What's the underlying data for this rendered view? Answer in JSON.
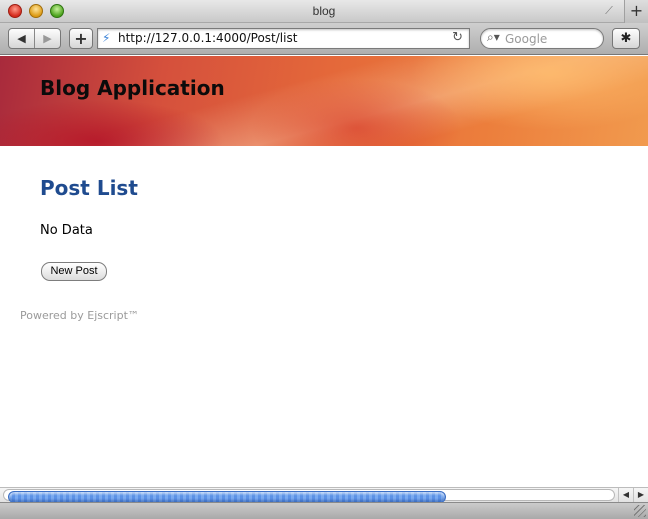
{
  "window": {
    "title": "blog",
    "new_tab_label": "+"
  },
  "toolbar": {
    "back_icon": "◀",
    "forward_icon": "▶",
    "add_bookmark_icon": "+",
    "url": "http://127.0.0.1:4000/Post/list",
    "favicon": "⚡",
    "reload_icon": "↻",
    "search_placeholder": "Google",
    "search_icon": "🔍",
    "bug_icon": "✱"
  },
  "page": {
    "app_title": "Blog Application",
    "heading": "Post List",
    "empty_message": "No Data",
    "new_post_label": "New Post",
    "footer": "Powered by Ejscript™"
  },
  "scrollbar": {
    "left_icon": "◀",
    "right_icon": "▶"
  },
  "colors": {
    "heading": "#1f4b8f",
    "footer_text": "#9a9a9a",
    "scroll_thumb": "#5c92e6"
  }
}
